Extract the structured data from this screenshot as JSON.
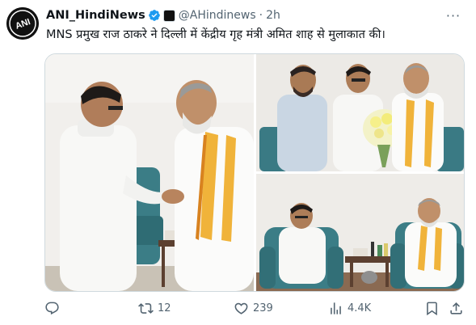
{
  "tweet": {
    "display_name": "ANI_HindiNews",
    "handle": "@AHindinews",
    "separator": "·",
    "time": "2h",
    "text": "MNS प्रमुख राज ठाकरे ने दिल्ली में केंद्रीय गृह मंत्री अमित शाह से मुलाकात की।",
    "avatar_text": "ANI"
  },
  "icons": {
    "verified": "verified-badge-icon",
    "affiliate": "affiliate-badge-icon",
    "more": "more-icon",
    "reply": "reply-icon",
    "retweet": "retweet-icon",
    "like": "like-icon",
    "views": "views-icon",
    "bookmark": "bookmark-icon",
    "share": "share-icon"
  },
  "more_label": "···",
  "stats": {
    "replies": "",
    "retweets": "12",
    "likes": "239",
    "views": "4.4K"
  },
  "colors": {
    "verified_blue": "#1d9bf0",
    "secondary_text": "#536471",
    "primary_text": "#0f1419",
    "border": "#cfd9de"
  }
}
